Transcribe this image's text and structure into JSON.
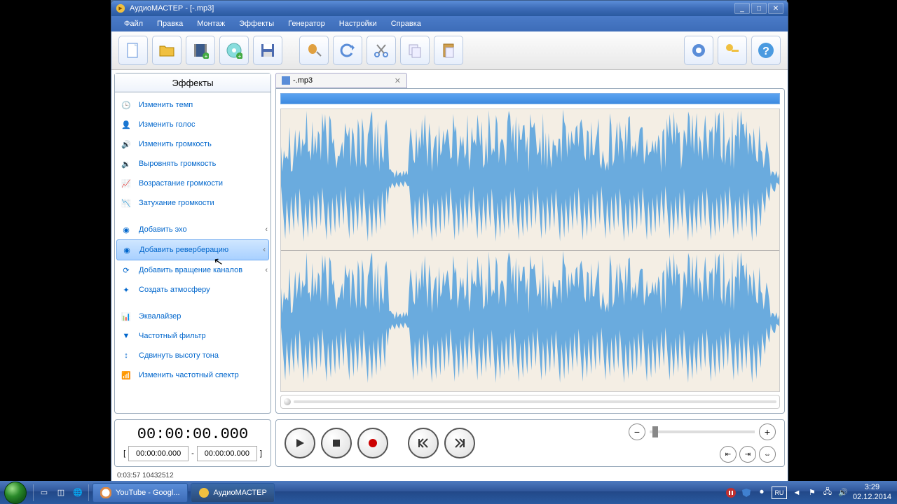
{
  "title": "АудиоМАСТЕР - [-.mp3]",
  "menu": {
    "file": "Файл",
    "edit": "Правка",
    "montage": "Монтаж",
    "effects": "Эффекты",
    "generator": "Генератор",
    "settings": "Настройки",
    "help": "Справка"
  },
  "effects_header": "Эффекты",
  "effects": {
    "group1": [
      {
        "label": "Изменить темп",
        "icon": "🕒"
      },
      {
        "label": "Изменить голос",
        "icon": "👤"
      },
      {
        "label": "Изменить громкость",
        "icon": "🔊"
      },
      {
        "label": "Выровнять громкость",
        "icon": "🔉"
      },
      {
        "label": "Возрастание громкости",
        "icon": "📈"
      },
      {
        "label": "Затухание громкости",
        "icon": "📉"
      }
    ],
    "group2": [
      {
        "label": "Добавить эхо",
        "icon": "◉",
        "arrow": true
      },
      {
        "label": "Добавить реверберацию",
        "icon": "◉",
        "arrow": true,
        "selected": true
      },
      {
        "label": "Добавить вращение каналов",
        "icon": "⟳",
        "arrow": true
      },
      {
        "label": "Создать атмосферу",
        "icon": "✦"
      }
    ],
    "group3": [
      {
        "label": "Эквалайзер",
        "icon": "📊"
      },
      {
        "label": "Частотный фильтр",
        "icon": "▼"
      },
      {
        "label": "Сдвинуть высоту тона",
        "icon": "↕"
      },
      {
        "label": "Изменить частотный спектр",
        "icon": "📶"
      }
    ]
  },
  "tab_label": "-.mp3",
  "time": {
    "main": "00:00:00.000",
    "start": "00:00:00.000",
    "end": "00:00:00.000"
  },
  "status": "0:03:57 10432512",
  "taskbar": {
    "youtube": "YouTube - Googl...",
    "app": "АудиоМАСТЕР",
    "time": "3:29",
    "date": "02.12.2014"
  }
}
